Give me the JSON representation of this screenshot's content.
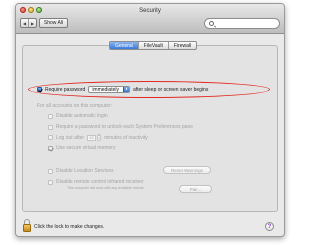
{
  "window": {
    "title": "Security",
    "show_all_label": "Show All",
    "back_glyph": "◀",
    "forward_glyph": "▶"
  },
  "search": {
    "placeholder": ""
  },
  "tabs": [
    {
      "label": "General",
      "active": true
    },
    {
      "label": "FileVault",
      "active": false
    },
    {
      "label": "Firewall",
      "active": false
    }
  ],
  "general": {
    "require_password_label": "Require password",
    "require_password_checked": true,
    "require_password_popup_value": "immediately",
    "after_sleep_label": "after sleep or screen saver begins",
    "all_accounts_heading": "For all accounts on this computer:",
    "disable_auto_login_label": "Disable automatic login",
    "require_pw_unlock_label": "Require a password to unlock each System Preferences pane",
    "logout_after_label": "Log out after",
    "logout_minutes_value": "60",
    "minutes_inactivity_label": "minutes of inactivity",
    "secure_vm_label": "Use secure virtual memory",
    "secure_vm_checked": true,
    "disable_location_label": "Disable Location Services",
    "reset_warnings_label": "Reset Warnings",
    "disable_ir_label": "Disable remote control infrared receiver",
    "pair_label": "Pair...",
    "ir_note": "This computer will work with any available remote."
  },
  "footer": {
    "lock_text": "Click the lock to make changes.",
    "help_glyph": "?"
  },
  "colors": {
    "highlight_oval": "#e22a22",
    "accent_blue": "#3a79d6",
    "disabled_text": "#a3a3a3"
  }
}
